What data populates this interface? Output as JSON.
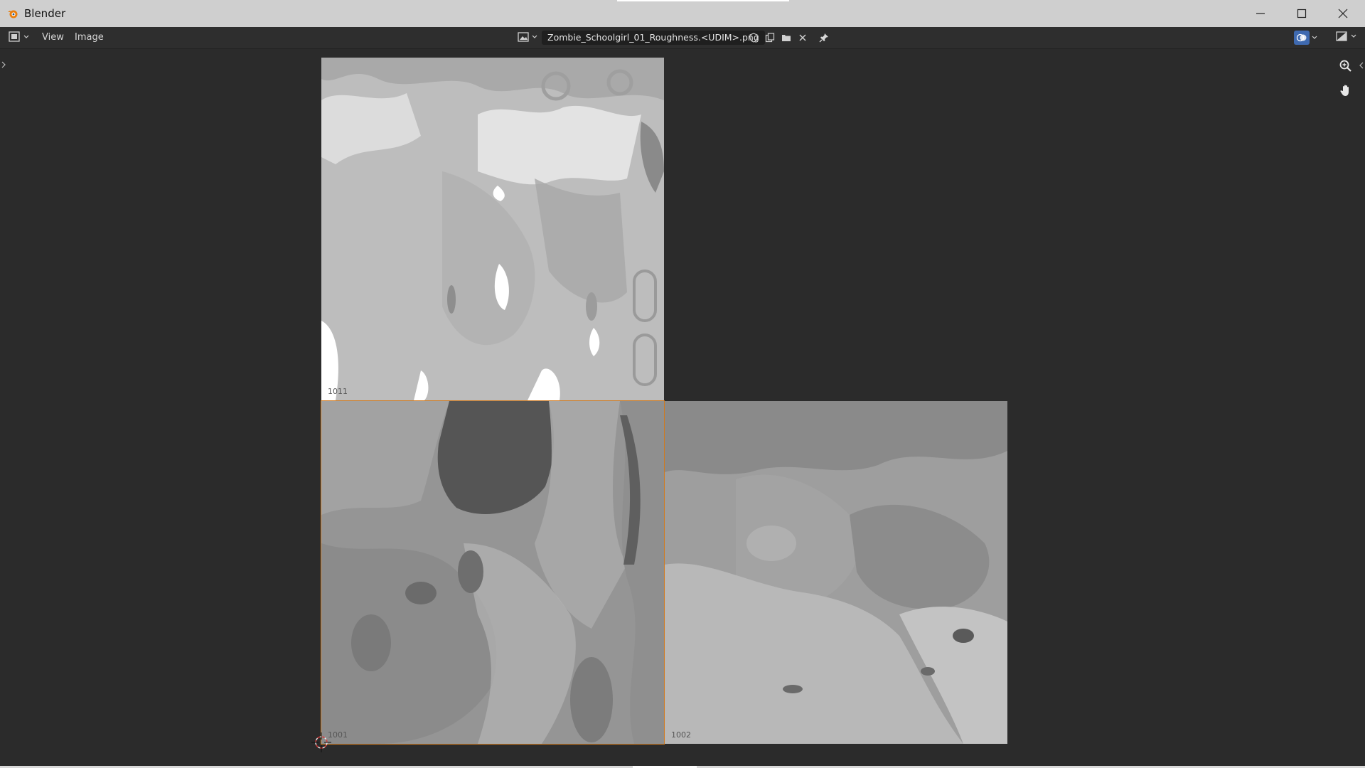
{
  "window": {
    "title": "Blender"
  },
  "header": {
    "menus": [
      "View",
      "Image"
    ],
    "image_name": "Zombie_Schoolgirl_01_Roughness.<UDIM>.png"
  },
  "tiles": [
    {
      "id": "1011",
      "label": "1011"
    },
    {
      "id": "1001",
      "label": "1001"
    },
    {
      "id": "1002",
      "label": "1002"
    }
  ],
  "colors": {
    "accent_active_tile": "#d07a1f",
    "overlay_button": "#3f6ab0",
    "viewport_bg": "#2b2b2b"
  },
  "icons": {
    "editor_type": "image-editor-icon",
    "gizmo_zoom": "zoom-icon",
    "gizmo_pan": "hand-pan-icon",
    "cursor": "2d-cursor-icon"
  }
}
